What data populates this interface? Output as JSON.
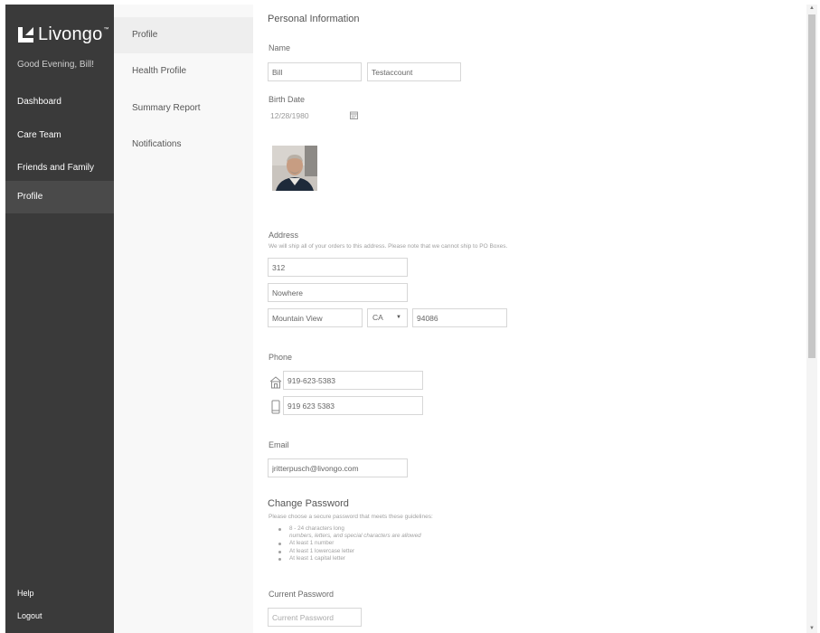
{
  "brand": {
    "name": "Livongo",
    "tm": "™"
  },
  "sidebar": {
    "greeting": "Good Evening, Bill!",
    "items": [
      {
        "label": "Dashboard"
      },
      {
        "label": "Care Team"
      },
      {
        "label": "Friends and Family"
      },
      {
        "label": "Profile",
        "active": true
      }
    ],
    "help": "Help",
    "logout": "Logout"
  },
  "subnav": {
    "items": [
      {
        "label": "Profile",
        "active": true
      },
      {
        "label": "Health Profile"
      },
      {
        "label": "Summary Report"
      },
      {
        "label": "Notifications"
      }
    ]
  },
  "personal": {
    "title": "Personal Information",
    "name_label": "Name",
    "first_name": "Bill",
    "last_name": "Testaccount",
    "birth_label": "Birth Date",
    "birth_value": "12/28/1980"
  },
  "address": {
    "title": "Address",
    "note": "We will ship all of your orders to this address. Please note that we cannot ship to PO Boxes.",
    "line1": "312",
    "line2": "Nowhere",
    "city": "Mountain View",
    "state": "CA",
    "zip": "94086"
  },
  "phone": {
    "title": "Phone",
    "home": "919-623-5383",
    "mobile": "919 623 5383",
    "home_icon": "home-icon",
    "mobile_icon": "mobile-phone-icon"
  },
  "email": {
    "title": "Email",
    "value": "jritterpusch@livongo.com"
  },
  "password": {
    "title": "Change Password",
    "note": "Please choose a secure password that meets these guidelines:",
    "rules": [
      "8 - 24 characters long",
      "numbers, letters, and special characters are allowed",
      "At least 1 number",
      "At least 1 lowercase letter",
      "At least 1 capital letter"
    ],
    "current_label": "Current Password",
    "current_placeholder": "Current Password"
  },
  "colors": {
    "sidebar_bg": "#3a3a3a",
    "sidebar_active": "#4a4a4a",
    "subnav_bg": "#f8f8f8",
    "subnav_active": "#eeeeee"
  }
}
